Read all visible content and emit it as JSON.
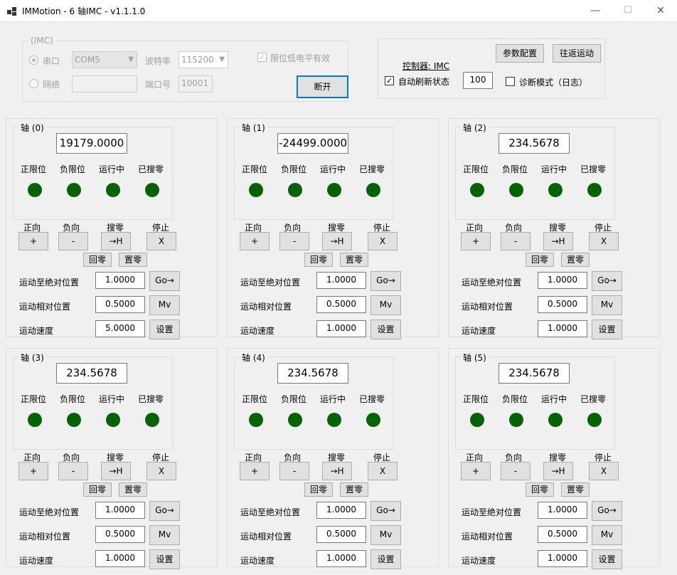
{
  "window": {
    "title": "IMMotion - 6 轴IMC - v1.1.1.0",
    "minimize": "—",
    "maximize": "☐",
    "close": "✕"
  },
  "conn": {
    "group_label": "(IMC)",
    "serial_label": "串口",
    "com_value": "COM5",
    "baud_label": "波特率",
    "baud_value": "115200",
    "limit_label": "限位低电平有效",
    "net_label": "网络",
    "ip_value": "",
    "port_label": "端口号",
    "port_value": "10001",
    "disconnect_label": "断开"
  },
  "ctrl": {
    "controller_label": "控制器: IMC",
    "param_label": "参数配置",
    "reciprocate_label": "往返运动",
    "auto_refresh_label": "自动刷新状态",
    "auto_refresh_checked": "✓",
    "refresh_value": "100",
    "diag_label": "诊断模式（日志）"
  },
  "labels": {
    "pos_limit": "正限位",
    "neg_limit": "负限位",
    "running": "运行中",
    "homed": "已搜零",
    "forward": "正向",
    "backward": "负向",
    "search_zero": "搜零",
    "stop": "停止",
    "plus": "+",
    "minus": "-",
    "goto_home": "→H",
    "x": "X",
    "return_zero": "回零",
    "set_zero": "置零",
    "abs_move": "运动至绝对位置",
    "rel_move": "运动相对位置",
    "speed": "运动速度",
    "go": "Go→",
    "mv": "Mv",
    "set": "设置"
  },
  "status_color": "#006400",
  "axes": [
    {
      "name": "轴 (0)",
      "position": "19179.0000",
      "abs": "1.0000",
      "rel": "0.5000",
      "speed": "5.0000"
    },
    {
      "name": "轴 (1)",
      "position": "-24499.0000",
      "abs": "1.0000",
      "rel": "0.5000",
      "speed": "1.0000"
    },
    {
      "name": "轴 (2)",
      "position": "234.5678",
      "abs": "1.0000",
      "rel": "0.5000",
      "speed": "1.0000"
    },
    {
      "name": "轴 (3)",
      "position": "234.5678",
      "abs": "1.0000",
      "rel": "0.5000",
      "speed": "1.0000"
    },
    {
      "name": "轴 (4)",
      "position": "234.5678",
      "abs": "1.0000",
      "rel": "0.5000",
      "speed": "1.0000"
    },
    {
      "name": "轴 (5)",
      "position": "234.5678",
      "abs": "1.0000",
      "rel": "0.5000",
      "speed": "1.0000"
    }
  ]
}
